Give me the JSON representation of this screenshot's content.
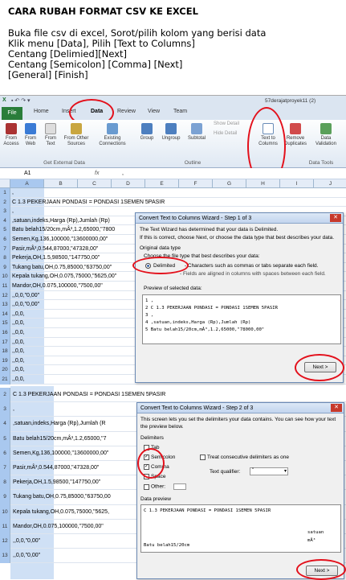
{
  "instructions": {
    "title": "CARA RUBAH FORMAT CSV KE EXCEL",
    "lines": [
      "Buka file csv di excel, Sorot/pilih kolom yang berisi data",
      "Klik menu [Data], Pilih [Text to Columns]",
      "Centang [Delimied][Next]",
      "Centang [Semicolon] [Comma] [Next]",
      "[General] [Finish]"
    ]
  },
  "excel": {
    "window_title": "57derajatproyek11 (2)",
    "tabs": [
      "File",
      "Home",
      "Insert",
      "Data",
      "Review",
      "View",
      "Team"
    ],
    "active_tab": "Data",
    "ribbon": {
      "from_access": "From Access",
      "from_web": "From Web",
      "from_text": "From Text",
      "from_other": "From Other Sources",
      "existing": "Existing Connections",
      "group_get_external": "Get External Data",
      "group": "Group",
      "ungroup": "Ungroup",
      "subtotal": "Subtotal",
      "group_outline": "Outline",
      "show_detail": "Show Detail",
      "hide_detail": "Hide Detail",
      "text_to_columns": "Text to Columns",
      "remove_duplicates": "Remove Duplicates",
      "data_validation": "Data Validation",
      "group_data_tools": "Data Tools"
    },
    "name_box": "A1",
    "formula_value": ",",
    "columns": [
      "A",
      "B",
      "C",
      "D",
      "E",
      "F",
      "G",
      "H",
      "I",
      "J"
    ],
    "rows": [
      {
        "n": "1",
        "text": ","
      },
      {
        "n": "2",
        "text": "C 1.3 PEKERJAAN PONDASI = PONDASI 1SEMEN 5PASIR"
      },
      {
        "n": "3",
        "text": ","
      },
      {
        "n": "4",
        "text": ",satuan,indeks,Harga (Rp),Jumlah (Rp)"
      },
      {
        "n": "5",
        "text": "Batu belah15/20cm,mÂ³,1.2,65000,\"7800"
      },
      {
        "n": "6",
        "text": "Semen,Kg,136,100000,\"13600000,00\""
      },
      {
        "n": "7",
        "text": "Pasir,mÂ³,0.544,87000,\"47328,00\""
      },
      {
        "n": "8",
        "text": "Pekerja,OH,1.5,98500,\"147750,00\""
      },
      {
        "n": "9",
        "text": "Tukang batu,OH,0.75,85000,\"63750,00\""
      },
      {
        "n": "10",
        "text": "Kepala tukang,OH,0.075,75000,\"5625,00\""
      },
      {
        "n": "11",
        "text": "Mandor,OH,0.075,100000,\"7500,00\""
      },
      {
        "n": "12",
        "text": ",,0,0,\"0,00\""
      },
      {
        "n": "13",
        "text": ",,0,0,\"0,00\""
      },
      {
        "n": "14",
        "text": ",,0,0,"
      },
      {
        "n": "15",
        "text": ",,0,0,"
      },
      {
        "n": "16",
        "text": ",,0,0,"
      },
      {
        "n": "17",
        "text": ",,0,0,"
      },
      {
        "n": "18",
        "text": ",,0,0,"
      },
      {
        "n": "19",
        "text": ",,0,0,"
      },
      {
        "n": "20",
        "text": ",,0,0,"
      },
      {
        "n": "21",
        "text": ",,0,0,"
      }
    ]
  },
  "wizard1": {
    "title": "Convert Text to Columns Wizard - Step 1 of 3",
    "line1": "The Text Wizard has determined that your data is Delimited.",
    "line2": "If this is correct, choose Next, or choose the data type that best describes your data.",
    "original_type": "Original data type",
    "choose": "Choose the file type that best describes your data:",
    "delimited": "Delimited",
    "delimited_desc": "- Characters such as commas or tabs separate each field.",
    "fixed_desc": "- Fields are aligned in columns with spaces between each field.",
    "preview_label": "Preview of selected data:",
    "preview": "1 ,\n2 C 1.3 PEKERJAAN PONDASI = PONDASI 1SEMEN 5PASIR\n3 ,\n4 ,satuan,indeks,Harga (Rp),Jumlah (Rp)\n5 Batu belah15/20cm,mÂ³,1.2,65000,\"78000,00\"",
    "next": "Next >"
  },
  "wizard2": {
    "title": "Convert Text to Columns Wizard - Step 2 of 3",
    "line1": "This screen lets you set the delimiters your data contains.  You can see how your text",
    "line2": "the preview below.",
    "delimiters": "Delimiters",
    "tab": "Tab",
    "semicolon": "Semicolon",
    "comma": "Comma",
    "space": "Space",
    "other": "Other:",
    "treat": "Treat consecutive delimiters as one",
    "qualifier": "Text qualifier:",
    "qualifier_val": "\"",
    "data_preview": "Data preview",
    "preview": "C 1.3 PEKERJAAN PONDASI = PONDASI 1SEMEN 5PASIR",
    "preview_right1": "satuan",
    "preview_right2": "mÂ³",
    "preview_row": "Batu belah15/20cm",
    "next": "Next >"
  },
  "sheet2": {
    "rows": [
      {
        "n": "2",
        "text": "C 1.3 PEKERJAAN PONDASI = PONDASI 1SEMEN 5PASIR"
      },
      {
        "n": "3",
        "text": ","
      },
      {
        "n": "4",
        "text": ",satuan,indeks,Harga (Rp),Jumlah (R"
      },
      {
        "n": "5",
        "text": "Batu belah15/20cm,mÂ³,1.2,65000,\"7"
      },
      {
        "n": "6",
        "text": "Semen,Kg,136,100000,\"13600000,00\""
      },
      {
        "n": "7",
        "text": "Pasir,mÂ³,0.544,87000,\"47328,00\""
      },
      {
        "n": "8",
        "text": "Pekerja,OH,1.5,98500,\"147750,00\""
      },
      {
        "n": "9",
        "text": "Tukang batu,OH,0.75,85000,\"63750,00"
      },
      {
        "n": "10",
        "text": "Kepala tukang,OH,0.075,75000,\"5625,"
      },
      {
        "n": "11",
        "text": "Mandor,OH,0.075,100000,\"7500,00\""
      },
      {
        "n": "12",
        "text": ",,0,0,\"0,00\""
      },
      {
        "n": "13",
        "text": ",,0,0,\"0,00\""
      }
    ]
  }
}
